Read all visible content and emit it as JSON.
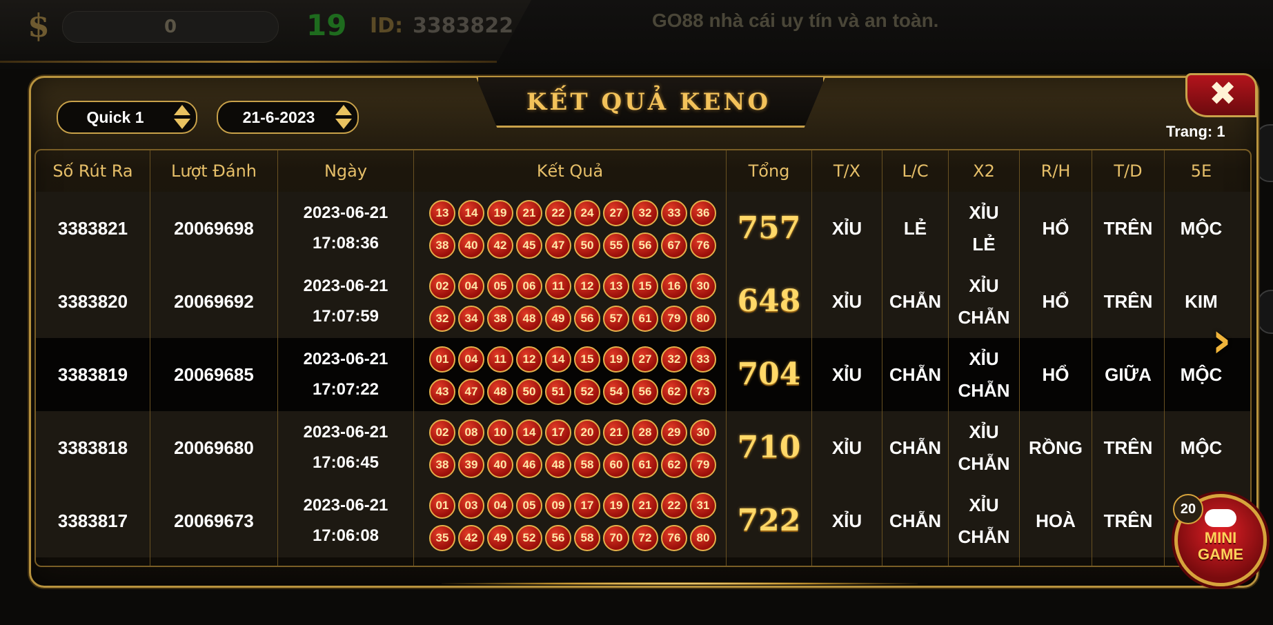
{
  "topbar": {
    "currency_icon": "$",
    "balance": "0",
    "level": "19",
    "id_label": "ID:",
    "id_value": "3383822",
    "marquee": "GO88 nhà cái uy tín và an toàn."
  },
  "panel": {
    "title": "KẾT QUẢ KENO",
    "close_icon": "close-icon",
    "room_select": "Quick 1",
    "date_select": "21-6-2023",
    "page_label": "Trang: 1"
  },
  "table": {
    "headers": [
      "Số Rút Ra",
      "Lượt Đánh",
      "Ngày",
      "Kết Quả",
      "Tổng",
      "T/X",
      "L/C",
      "X2",
      "R/H",
      "T/D",
      "5E"
    ],
    "rows": [
      {
        "draw": "3383821",
        "bet_round": "20069698",
        "date": "2023-06-21",
        "time": "17:08:36",
        "numbers": [
          "13",
          "14",
          "19",
          "21",
          "22",
          "24",
          "27",
          "32",
          "33",
          "36",
          "38",
          "40",
          "42",
          "45",
          "47",
          "50",
          "55",
          "56",
          "67",
          "76"
        ],
        "total": "757",
        "tx": "XỈU",
        "lc": "LẺ",
        "x2_a": "XỈU",
        "x2_b": "LẺ",
        "rh": "HỔ",
        "td": "TRÊN",
        "e5": "MỘC"
      },
      {
        "draw": "3383820",
        "bet_round": "20069692",
        "date": "2023-06-21",
        "time": "17:07:59",
        "numbers": [
          "02",
          "04",
          "05",
          "06",
          "11",
          "12",
          "13",
          "15",
          "16",
          "30",
          "32",
          "34",
          "38",
          "48",
          "49",
          "56",
          "57",
          "61",
          "79",
          "80"
        ],
        "total": "648",
        "tx": "XỈU",
        "lc": "CHẴN",
        "x2_a": "XỈU",
        "x2_b": "CHẴN",
        "rh": "HỔ",
        "td": "TRÊN",
        "e5": "KIM"
      },
      {
        "draw": "3383819",
        "bet_round": "20069685",
        "date": "2023-06-21",
        "time": "17:07:22",
        "numbers": [
          "01",
          "04",
          "11",
          "12",
          "14",
          "15",
          "19",
          "27",
          "32",
          "33",
          "43",
          "47",
          "48",
          "50",
          "51",
          "52",
          "54",
          "56",
          "62",
          "73"
        ],
        "total": "704",
        "tx": "XỈU",
        "lc": "CHẴN",
        "x2_a": "XỈU",
        "x2_b": "CHẴN",
        "rh": "HỔ",
        "td": "GIỮA",
        "e5": "MỘC"
      },
      {
        "draw": "3383818",
        "bet_round": "20069680",
        "date": "2023-06-21",
        "time": "17:06:45",
        "numbers": [
          "02",
          "08",
          "10",
          "14",
          "17",
          "20",
          "21",
          "28",
          "29",
          "30",
          "38",
          "39",
          "40",
          "46",
          "48",
          "58",
          "60",
          "61",
          "62",
          "79"
        ],
        "total": "710",
        "tx": "XỈU",
        "lc": "CHẴN",
        "x2_a": "XỈU",
        "x2_b": "CHẴN",
        "rh": "RỒNG",
        "td": "TRÊN",
        "e5": "MỘC"
      },
      {
        "draw": "3383817",
        "bet_round": "20069673",
        "date": "2023-06-21",
        "time": "17:06:08",
        "numbers": [
          "01",
          "03",
          "04",
          "05",
          "09",
          "17",
          "19",
          "21",
          "22",
          "31",
          "35",
          "42",
          "49",
          "52",
          "56",
          "58",
          "70",
          "72",
          "76",
          "80"
        ],
        "total": "722",
        "tx": "XỈU",
        "lc": "CHẴN",
        "x2_a": "XỈU",
        "x2_b": "CHẴN",
        "rh": "HOÀ",
        "td": "TRÊN",
        "e5": ""
      }
    ]
  },
  "side": {
    "next_icon": "chevron-right-icon",
    "mini_game_label_1": "MINI",
    "mini_game_label_2": "GAME",
    "mini_game_badge": "20"
  },
  "colors": {
    "gold": "#e6bf69",
    "total_gold": "#ffd868",
    "ball_red": "#c0261a",
    "close_red": "#b3141c"
  }
}
